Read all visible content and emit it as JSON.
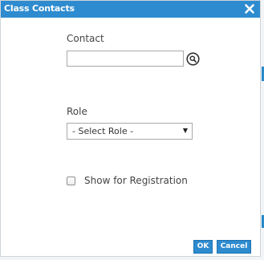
{
  "dialog": {
    "title": "Class Contacts",
    "close_icon": "close-icon",
    "accent_color": "#2e8bcf"
  },
  "contact": {
    "label": "Contact",
    "value": "",
    "search_icon": "search-icon"
  },
  "role": {
    "label": "Role",
    "selected": "- Select Role -",
    "caret_icon": "dropdown-caret-icon"
  },
  "registration": {
    "label": "Show for Registration",
    "checked": false
  },
  "footer": {
    "ok_label": "OK",
    "cancel_label": "Cancel"
  }
}
